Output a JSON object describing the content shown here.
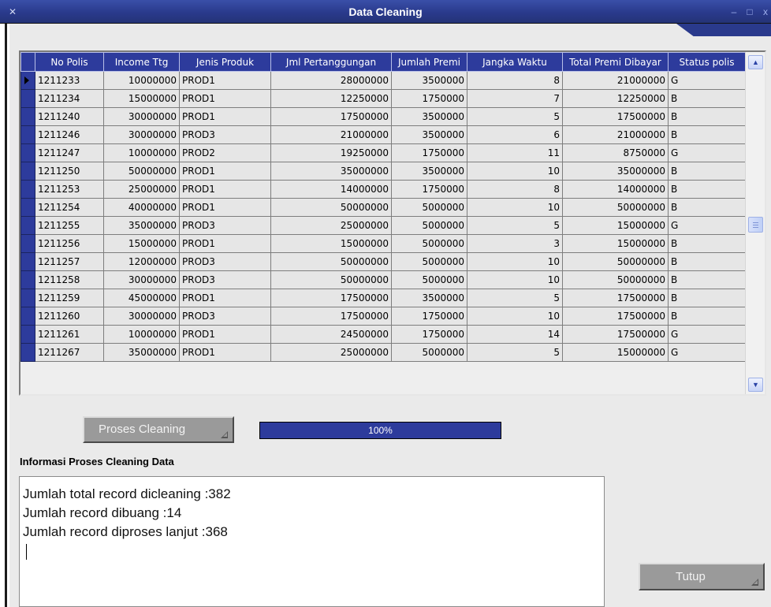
{
  "window": {
    "title": "Data Cleaning",
    "icon": "x-icon",
    "controls": {
      "minimize": "–",
      "maximize": "□",
      "close": "x"
    }
  },
  "grid": {
    "columns": [
      "No Polis",
      "Income Ttg",
      "Jenis Produk",
      "Jml Pertanggungan",
      "Jumlah Premi",
      "Jangka Waktu",
      "Total Premi Dibayar",
      "Status polis"
    ],
    "rows": [
      [
        "1211233",
        "10000000",
        "PROD1",
        "28000000",
        "3500000",
        "8",
        "21000000",
        "G"
      ],
      [
        "1211234",
        "15000000",
        "PROD1",
        "12250000",
        "1750000",
        "7",
        "12250000",
        "B"
      ],
      [
        "1211240",
        "30000000",
        "PROD1",
        "17500000",
        "3500000",
        "5",
        "17500000",
        "B"
      ],
      [
        "1211246",
        "30000000",
        "PROD3",
        "21000000",
        "3500000",
        "6",
        "21000000",
        "B"
      ],
      [
        "1211247",
        "10000000",
        "PROD2",
        "19250000",
        "1750000",
        "11",
        "8750000",
        "G"
      ],
      [
        "1211250",
        "50000000",
        "PROD1",
        "35000000",
        "3500000",
        "10",
        "35000000",
        "B"
      ],
      [
        "1211253",
        "25000000",
        "PROD1",
        "14000000",
        "1750000",
        "8",
        "14000000",
        "B"
      ],
      [
        "1211254",
        "40000000",
        "PROD1",
        "50000000",
        "5000000",
        "10",
        "50000000",
        "B"
      ],
      [
        "1211255",
        "35000000",
        "PROD3",
        "25000000",
        "5000000",
        "5",
        "15000000",
        "G"
      ],
      [
        "1211256",
        "15000000",
        "PROD1",
        "15000000",
        "5000000",
        "3",
        "15000000",
        "B"
      ],
      [
        "1211257",
        "12000000",
        "PROD3",
        "50000000",
        "5000000",
        "10",
        "50000000",
        "B"
      ],
      [
        "1211258",
        "30000000",
        "PROD3",
        "50000000",
        "5000000",
        "10",
        "50000000",
        "B"
      ],
      [
        "1211259",
        "45000000",
        "PROD1",
        "17500000",
        "3500000",
        "5",
        "17500000",
        "B"
      ],
      [
        "1211260",
        "30000000",
        "PROD3",
        "17500000",
        "1750000",
        "10",
        "17500000",
        "B"
      ],
      [
        "1211261",
        "10000000",
        "PROD1",
        "24500000",
        "1750000",
        "14",
        "17500000",
        "G"
      ],
      [
        "1211267",
        "35000000",
        "PROD1",
        "25000000",
        "5000000",
        "5",
        "15000000",
        "G"
      ]
    ]
  },
  "actions": {
    "proses_label": "Proses Cleaning",
    "tutup_label": "Tutup"
  },
  "progress": {
    "text": "100%",
    "value": 1.0
  },
  "info": {
    "label": "Informasi Proses Cleaning Data",
    "lines": [
      "Jumlah total record dicleaning :382",
      "Jumlah record dibuang :14",
      "Jumlah record diproses lanjut :368"
    ]
  },
  "colors": {
    "titlebar": "#2a3a8c",
    "grid_header": "#2d3b9c",
    "progress_fill": "#2d3b9c"
  }
}
